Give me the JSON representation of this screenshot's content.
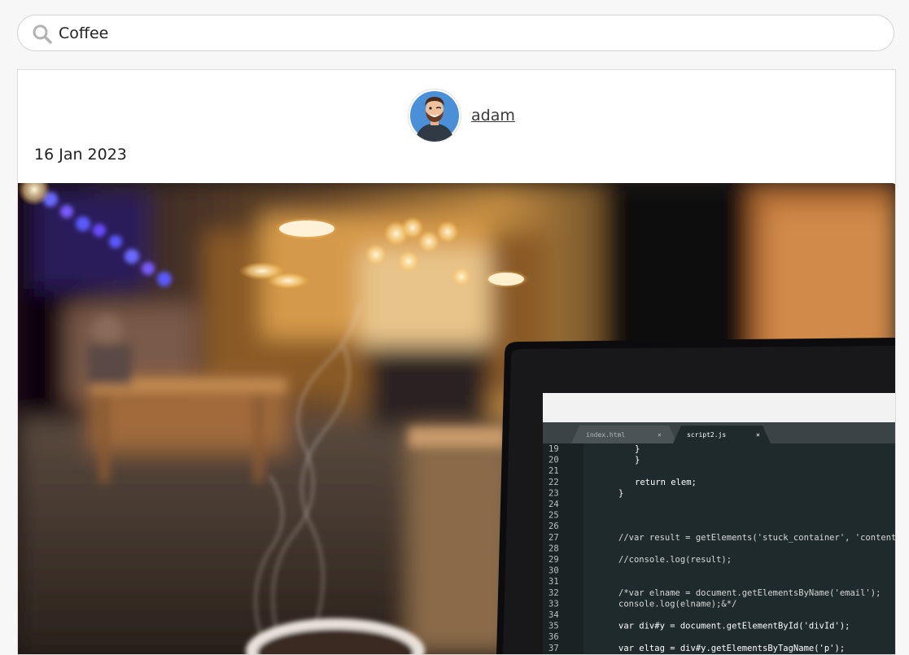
{
  "search": {
    "value": "Coffee",
    "icon": "search-icon"
  },
  "post": {
    "author": {
      "name": "adam",
      "avatar_icon": "avatar"
    },
    "date": "16 Jan 2023",
    "image": {
      "subject": "coffee-shop-laptop-photo",
      "tabs": [
        "index.html",
        "script2.js"
      ],
      "code_lines": [
        {
          "num": "19",
          "text": "}",
          "indent": 2,
          "color": "#ffffff"
        },
        {
          "num": "20",
          "text": "}",
          "indent": 2,
          "color": "#ffffff"
        },
        {
          "num": "21",
          "text": "",
          "indent": 0,
          "color": "#ffffff"
        },
        {
          "num": "22",
          "text": "return elem;",
          "indent": 2,
          "color": "#ffffff"
        },
        {
          "num": "23",
          "text": "}",
          "indent": 1,
          "color": "#ffffff"
        },
        {
          "num": "24",
          "text": "",
          "indent": 0,
          "color": "#ffffff"
        },
        {
          "num": "25",
          "text": "",
          "indent": 0,
          "color": "#ffffff"
        },
        {
          "num": "26",
          "text": "",
          "indent": 0,
          "color": "#ffffff"
        },
        {
          "num": "27",
          "text": "//var result = getElements('stuck_container', 'content",
          "indent": 1,
          "color": "#d8d8d8"
        },
        {
          "num": "28",
          "text": "",
          "indent": 0,
          "color": "#ffffff"
        },
        {
          "num": "29",
          "text": "//console.log(result);",
          "indent": 1,
          "color": "#d8d8d8"
        },
        {
          "num": "30",
          "text": "",
          "indent": 0,
          "color": "#ffffff"
        },
        {
          "num": "31",
          "text": "",
          "indent": 0,
          "color": "#ffffff"
        },
        {
          "num": "32",
          "text": "/*var elname = document.getElementsByName('email');",
          "indent": 1,
          "color": "#d8d8d8"
        },
        {
          "num": "33",
          "text": "console.log(elname);&*/",
          "indent": 1,
          "color": "#d8d8d8"
        },
        {
          "num": "34",
          "text": "",
          "indent": 0,
          "color": "#ffffff"
        },
        {
          "num": "35",
          "text": "var div#y = document.getElementById('divId');",
          "indent": 1,
          "color": "#ffffff"
        },
        {
          "num": "36",
          "text": "",
          "indent": 0,
          "color": "#ffffff"
        },
        {
          "num": "37",
          "text": "var eltag = div#y.getElementsByTagName('p');",
          "indent": 1,
          "color": "#ffffff"
        }
      ]
    }
  },
  "colors": {
    "page_bg": "#f7f7f7",
    "card_bg": "#ffffff",
    "avatar_bg": "#4a90d9",
    "link_text": "#3a3a3a"
  }
}
